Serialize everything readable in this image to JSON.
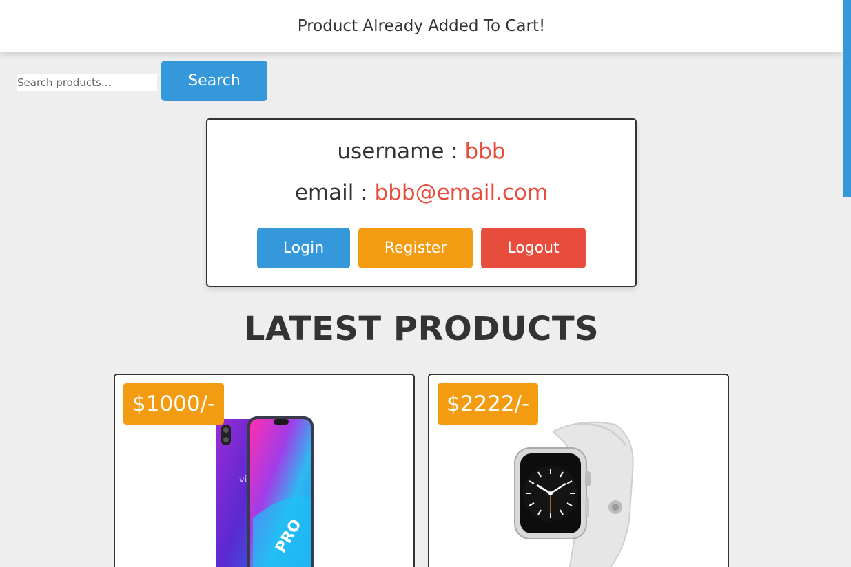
{
  "message": {
    "text": "Product Already Added To Cart!"
  },
  "search": {
    "placeholder": "Search products...",
    "button_label": "Search"
  },
  "user": {
    "username_label": "username : ",
    "username_value": "bbb",
    "email_label": "email : ",
    "email_value": "bbb@email.com",
    "buttons": {
      "login": "Login",
      "register": "Register",
      "logout": "Logout"
    }
  },
  "section": {
    "title": "LATEST PRODUCTS"
  },
  "products": [
    {
      "price": "$1000/-",
      "image_icon": "smartphone-image"
    },
    {
      "price": "$2222/-",
      "image_icon": "smartwatch-image"
    }
  ],
  "colors": {
    "primary_blue": "#3498db",
    "orange": "#f39c12",
    "red": "#e74c3c",
    "text_dark": "#333333",
    "background": "#eeeeee"
  }
}
